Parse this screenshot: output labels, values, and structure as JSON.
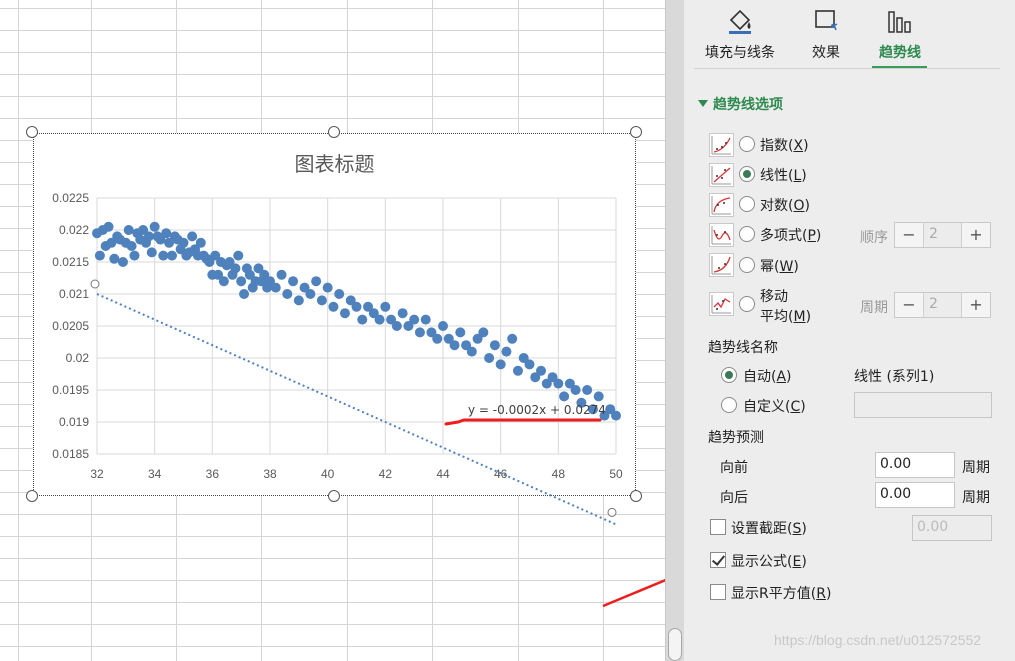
{
  "tabs": [
    {
      "label": "填充与线条",
      "icon": "fill-line-icon"
    },
    {
      "label": "效果",
      "icon": "effects-icon"
    },
    {
      "label": "趋势线",
      "icon": "trendline-bars-icon",
      "active": true
    }
  ],
  "section_title": "趋势线选项",
  "trend_types": [
    {
      "label": "指数(",
      "key": "X",
      "suffix": ")",
      "selected": false,
      "icon": "exponential-trend-icon"
    },
    {
      "label": "线性(",
      "key": "L",
      "suffix": ")",
      "selected": true,
      "icon": "linear-trend-icon"
    },
    {
      "label": "对数(",
      "key": "O",
      "suffix": ")",
      "selected": false,
      "icon": "logarithmic-trend-icon"
    },
    {
      "label": "多项式(",
      "key": "P",
      "suffix": ")",
      "selected": false,
      "icon": "polynomial-trend-icon"
    },
    {
      "label": "幂(",
      "key": "W",
      "suffix": ")",
      "selected": false,
      "icon": "power-trend-icon"
    },
    {
      "label_line1": "移动",
      "label_line2": "平均(",
      "key": "M",
      "suffix": ")",
      "selected": false,
      "icon": "moving-average-trend-icon"
    }
  ],
  "order": {
    "label": "顺序",
    "value": "2"
  },
  "period": {
    "label": "周期",
    "value": "2"
  },
  "name_section": {
    "title": "趋势线名称",
    "auto_label": "自动(",
    "auto_key": "A",
    "auto_suffix": ")",
    "auto_value": "线性 (系列1)",
    "custom_label": "自定义(",
    "custom_key": "C",
    "custom_suffix": ")",
    "auto_selected": true
  },
  "forecast": {
    "title": "趋势预测",
    "forward_label": "向前",
    "forward_value": "0.00",
    "forward_unit": "周期",
    "backward_label": "向后",
    "backward_value": "0.00",
    "backward_unit": "周期"
  },
  "intercept": {
    "label": "设置截距(",
    "key": "S",
    "suffix": ")",
    "checked": false,
    "value": "0.00"
  },
  "show_equation": {
    "label": "显示公式(",
    "key": "E",
    "suffix": ")",
    "checked": true
  },
  "show_r2": {
    "label": "显示R平方值(",
    "key": "R",
    "suffix": ")",
    "checked": false
  },
  "watermark": "https://blog.csdn.net/u012572552",
  "colors": {
    "accent": "#2f8a4f",
    "marker": "#4f81bd",
    "annotation": "#ee1c1c"
  },
  "chart_data": {
    "type": "scatter",
    "title": "图表标题",
    "xlim": [
      32,
      50
    ],
    "ylim": [
      0.0185,
      0.0225
    ],
    "x_ticks": [
      "32",
      "34",
      "36",
      "38",
      "40",
      "42",
      "44",
      "46",
      "48",
      "50"
    ],
    "y_ticks": [
      "0.0185",
      "0.019",
      "0.0195",
      "0.02",
      "0.0205",
      "0.021",
      "0.0215",
      "0.022",
      "0.0225"
    ],
    "grid": true,
    "trendline": {
      "type": "linear",
      "equation": "y = -0.0002x + 0.0274"
    },
    "series": [
      {
        "points": [
          [
            32.0,
            0.02195
          ],
          [
            32.1,
            0.0216
          ],
          [
            32.2,
            0.022
          ],
          [
            32.3,
            0.02175
          ],
          [
            32.4,
            0.02205
          ],
          [
            32.5,
            0.0218
          ],
          [
            32.6,
            0.02155
          ],
          [
            32.7,
            0.0219
          ],
          [
            32.8,
            0.02185
          ],
          [
            32.9,
            0.0215
          ],
          [
            33.0,
            0.0218
          ],
          [
            33.1,
            0.022
          ],
          [
            33.2,
            0.02175
          ],
          [
            33.3,
            0.0216
          ],
          [
            33.4,
            0.02195
          ],
          [
            33.5,
            0.02185
          ],
          [
            33.6,
            0.022
          ],
          [
            33.7,
            0.0218
          ],
          [
            33.8,
            0.0219
          ],
          [
            33.9,
            0.02165
          ],
          [
            34.0,
            0.02205
          ],
          [
            34.1,
            0.0219
          ],
          [
            34.2,
            0.02185
          ],
          [
            34.3,
            0.0216
          ],
          [
            34.4,
            0.02195
          ],
          [
            34.5,
            0.0218
          ],
          [
            34.6,
            0.0216
          ],
          [
            34.7,
            0.0219
          ],
          [
            34.8,
            0.02185
          ],
          [
            34.9,
            0.0217
          ],
          [
            35.0,
            0.0218
          ],
          [
            35.1,
            0.0216
          ],
          [
            35.2,
            0.02165
          ],
          [
            35.3,
            0.0219
          ],
          [
            35.4,
            0.0217
          ],
          [
            35.5,
            0.0216
          ],
          [
            35.6,
            0.0218
          ],
          [
            35.7,
            0.0216
          ],
          [
            35.8,
            0.02155
          ],
          [
            35.9,
            0.0215
          ],
          [
            36.0,
            0.0213
          ],
          [
            36.1,
            0.0216
          ],
          [
            36.2,
            0.0213
          ],
          [
            36.3,
            0.0215
          ],
          [
            36.4,
            0.0212
          ],
          [
            36.5,
            0.02145
          ],
          [
            36.6,
            0.0215
          ],
          [
            36.7,
            0.0213
          ],
          [
            36.8,
            0.0214
          ],
          [
            36.9,
            0.0216
          ],
          [
            37.0,
            0.0212
          ],
          [
            37.1,
            0.021
          ],
          [
            37.2,
            0.0214
          ],
          [
            37.3,
            0.0213
          ],
          [
            37.4,
            0.0211
          ],
          [
            37.5,
            0.0212
          ],
          [
            37.6,
            0.0214
          ],
          [
            37.7,
            0.0212
          ],
          [
            37.8,
            0.0213
          ],
          [
            37.9,
            0.0211
          ],
          [
            38.0,
            0.0212
          ],
          [
            38.2,
            0.0211
          ],
          [
            38.4,
            0.0213
          ],
          [
            38.6,
            0.021
          ],
          [
            38.8,
            0.0212
          ],
          [
            39.0,
            0.0209
          ],
          [
            39.2,
            0.0211
          ],
          [
            39.4,
            0.021
          ],
          [
            39.6,
            0.0212
          ],
          [
            39.8,
            0.0209
          ],
          [
            40.0,
            0.0211
          ],
          [
            40.2,
            0.0208
          ],
          [
            40.4,
            0.021
          ],
          [
            40.6,
            0.0207
          ],
          [
            40.8,
            0.0209
          ],
          [
            41.0,
            0.0208
          ],
          [
            41.2,
            0.0206
          ],
          [
            41.4,
            0.0208
          ],
          [
            41.6,
            0.0207
          ],
          [
            41.8,
            0.0206
          ],
          [
            42.0,
            0.0208
          ],
          [
            42.2,
            0.0206
          ],
          [
            42.4,
            0.0205
          ],
          [
            42.6,
            0.0207
          ],
          [
            42.8,
            0.0205
          ],
          [
            43.0,
            0.0206
          ],
          [
            43.2,
            0.0204
          ],
          [
            43.4,
            0.0206
          ],
          [
            43.6,
            0.0204
          ],
          [
            43.8,
            0.0203
          ],
          [
            44.0,
            0.0205
          ],
          [
            44.2,
            0.0203
          ],
          [
            44.4,
            0.0202
          ],
          [
            44.6,
            0.0204
          ],
          [
            44.8,
            0.0202
          ],
          [
            45.0,
            0.0201
          ],
          [
            45.2,
            0.0203
          ],
          [
            45.4,
            0.0204
          ],
          [
            45.6,
            0.02
          ],
          [
            45.8,
            0.0202
          ],
          [
            46.0,
            0.0199
          ],
          [
            46.2,
            0.0201
          ],
          [
            46.4,
            0.0203
          ],
          [
            46.6,
            0.0198
          ],
          [
            46.8,
            0.02
          ],
          [
            47.0,
            0.0199
          ],
          [
            47.2,
            0.0197
          ],
          [
            47.4,
            0.0198
          ],
          [
            47.6,
            0.0196
          ],
          [
            47.8,
            0.0197
          ],
          [
            48.0,
            0.0196
          ],
          [
            48.2,
            0.0194
          ],
          [
            48.4,
            0.0196
          ],
          [
            48.6,
            0.0195
          ],
          [
            48.8,
            0.0193
          ],
          [
            49.0,
            0.0195
          ],
          [
            49.2,
            0.0192
          ],
          [
            49.4,
            0.0194
          ],
          [
            49.6,
            0.0191
          ],
          [
            49.8,
            0.0192
          ],
          [
            50.0,
            0.0191
          ]
        ]
      }
    ]
  }
}
